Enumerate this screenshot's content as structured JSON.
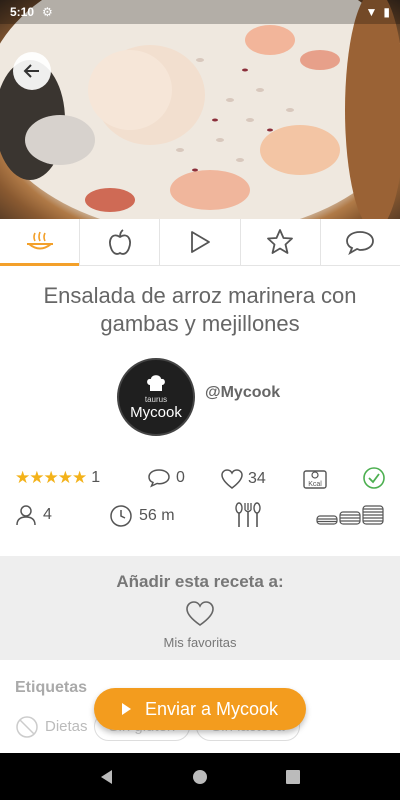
{
  "status_bar": {
    "time": "5:10"
  },
  "recipe": {
    "title": "Ensalada de arroz marinera con gambas y mejillones",
    "author": "@Mycook",
    "avatar_brand_small": "taurus",
    "avatar_brand": "Mycook"
  },
  "tabs": [
    {
      "icon": "cooking-pot-icon",
      "active": true
    },
    {
      "icon": "apple-icon",
      "active": false
    },
    {
      "icon": "play-icon",
      "active": false
    },
    {
      "icon": "star-icon",
      "active": false
    },
    {
      "icon": "comment-icon",
      "active": false
    }
  ],
  "stats": {
    "rating_stars": 5,
    "rating_count": "1",
    "comments": "0",
    "likes": "34",
    "kcal_label": "Kcal",
    "servings": "4",
    "time": "56 m"
  },
  "add_section": {
    "title": "Añadir esta receta a:",
    "favorites_label": "Mis favoritas"
  },
  "tags": {
    "label": "Etiquetas",
    "items": [
      "Dietas",
      "Sin gluten",
      "Sin lactosa"
    ]
  },
  "send_button": {
    "label": "Enviar a Mycook"
  },
  "colors": {
    "accent": "#f39c1e",
    "star": "#f3b21a",
    "check": "#4caf50"
  }
}
